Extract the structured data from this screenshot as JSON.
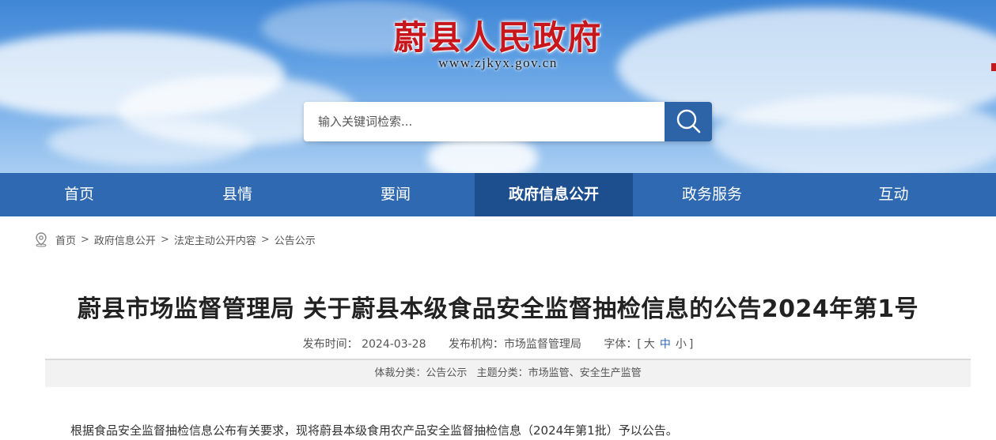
{
  "header": {
    "site_title": "蔚县人民政府",
    "site_url": "www.zjkyx.gov.cn",
    "search_placeholder": "输入关键词检索...",
    "accent_color": "#c8161d"
  },
  "nav": {
    "items": [
      {
        "label": "首页"
      },
      {
        "label": "县情"
      },
      {
        "label": "要闻"
      },
      {
        "label": "政府信息公开",
        "active": true
      },
      {
        "label": "政务服务"
      },
      {
        "label": "互动"
      }
    ],
    "bg_color": "#2f69b1",
    "active_color": "#1d4f8f"
  },
  "breadcrumb": {
    "icon": "location-pin-icon",
    "items": [
      "首页",
      "政府信息公开",
      "法定主动公开内容",
      "公告公示"
    ],
    "separator": ">"
  },
  "article": {
    "title": "蔚县市场监督管理局 关于蔚县本级食品安全监督抽检信息的公告2024年第1号",
    "publish_time_label": "发布时间：",
    "publish_time": "2024-03-28",
    "publisher_label": "发布机构：",
    "publisher": "市场监督管理局",
    "font_size_label": "字体：",
    "font_size_open": "[",
    "font_sizes": [
      "大",
      "中",
      "小"
    ],
    "font_size_close": "]",
    "genre_label": "体裁分类：",
    "genre": "公告公示",
    "topic_label": "主题分类：",
    "topic": "市场监管、安全生产监管",
    "body_first_line": "根据食品安全监督抽检信息公布有关要求，现将蔚县本级食用农产品安全监督抽检信息（2024年第1批）予以公告。"
  }
}
